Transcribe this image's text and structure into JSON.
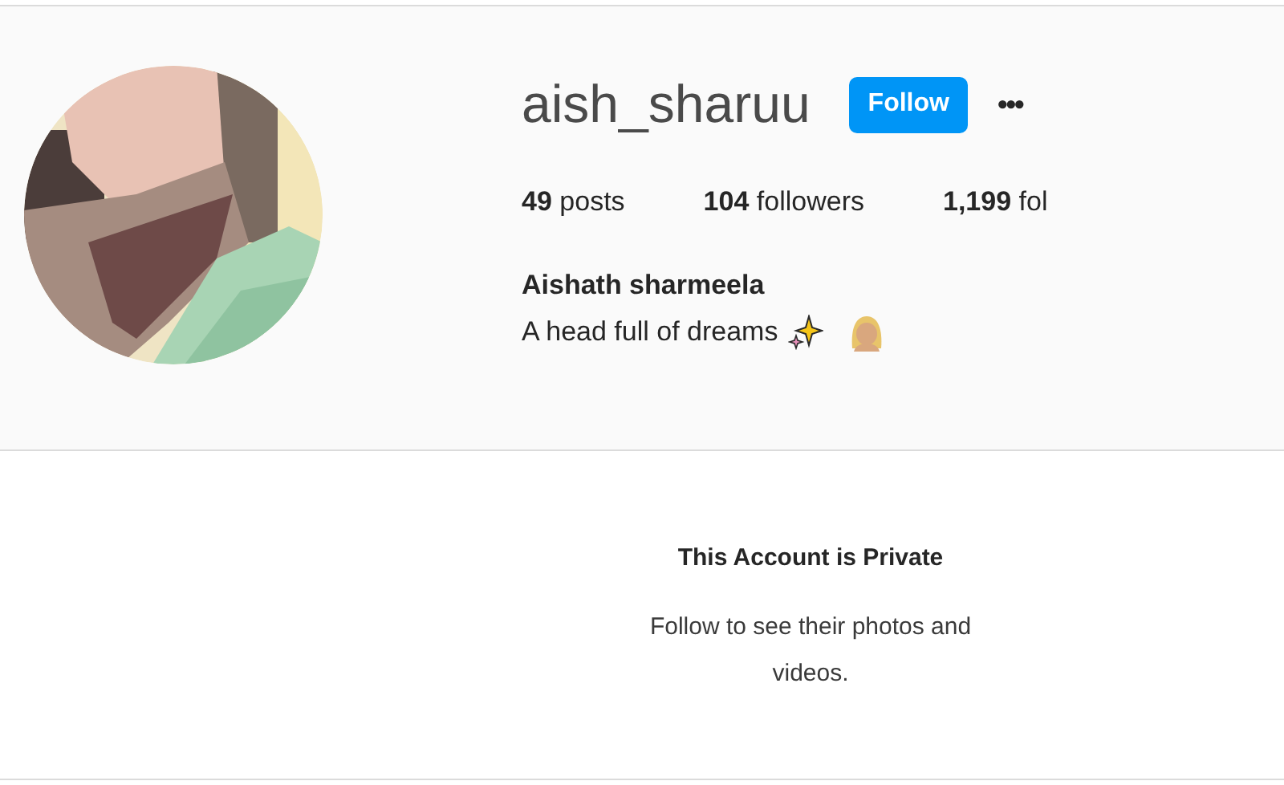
{
  "profile": {
    "username": "aish_sharuu",
    "follow_button": "Follow",
    "more_button": "•••",
    "stats": [
      {
        "count": "49",
        "label": "posts"
      },
      {
        "count": "104",
        "label": "followers"
      },
      {
        "count": "1,199",
        "label": "fol"
      }
    ],
    "full_name": "Aishath sharmeela",
    "bio": "A head full of dreams"
  },
  "private_notice": {
    "title": "This Account is Private",
    "message": "Follow to see their photos and videos."
  }
}
